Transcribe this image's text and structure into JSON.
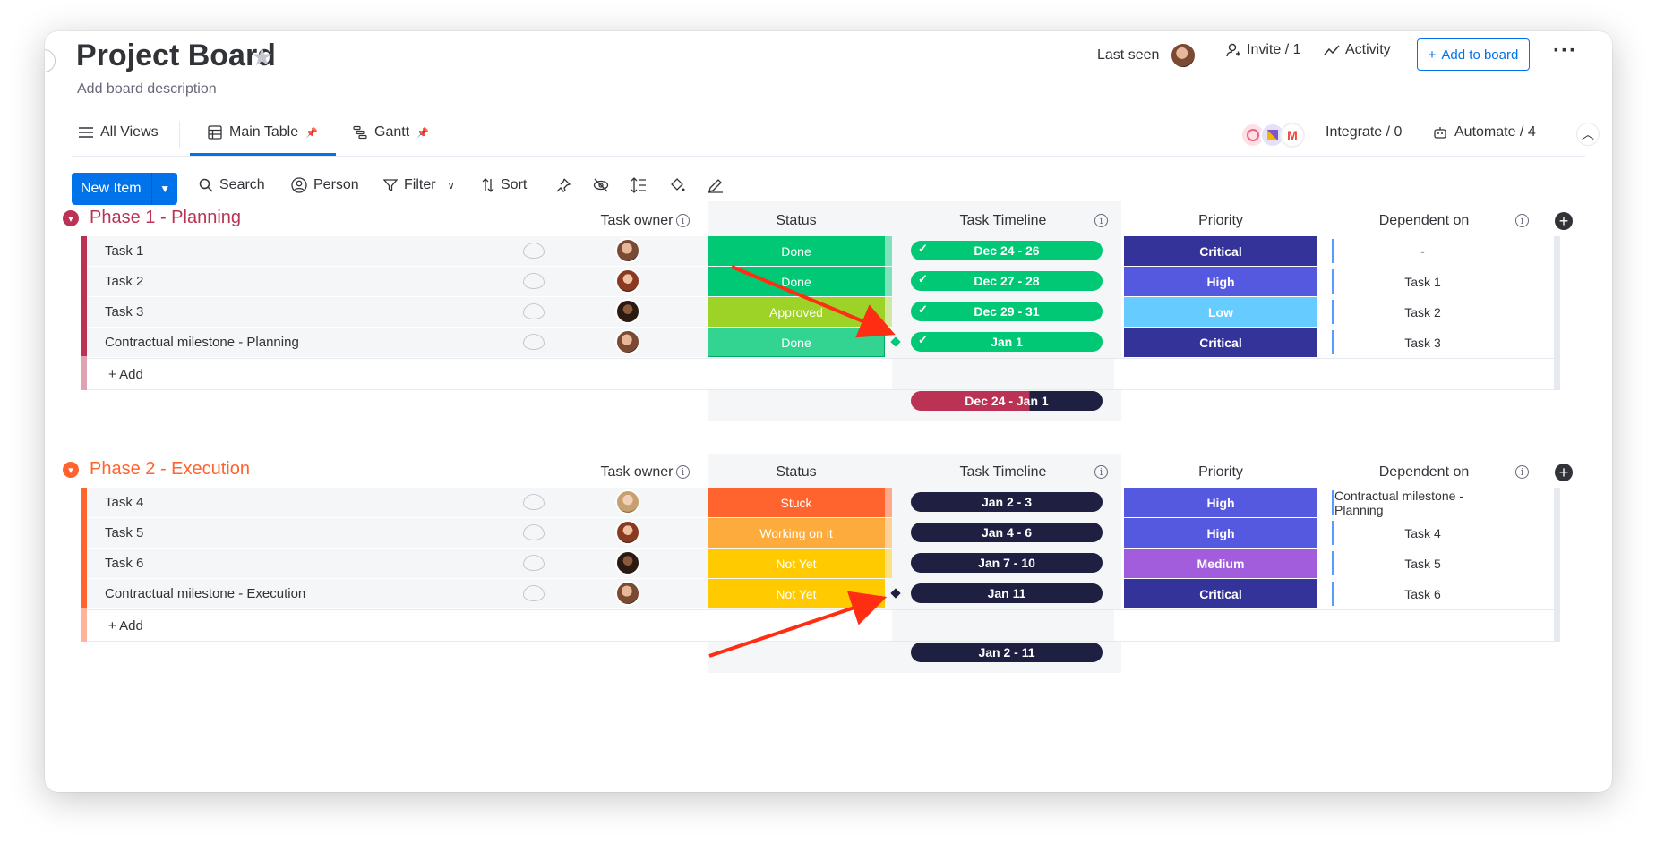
{
  "board": {
    "title": "Project Board",
    "description": "Add board description"
  },
  "header": {
    "last_seen": "Last seen",
    "invite": "Invite / 1",
    "activity": "Activity",
    "add_to_board": "Add to board"
  },
  "tabs": [
    {
      "label": "All Views",
      "icon": "list-icon"
    },
    {
      "label": "Main Table",
      "icon": "table-icon"
    },
    {
      "label": "Gantt",
      "icon": "gantt-icon"
    }
  ],
  "integrations": {
    "integrate": "Integrate / 0",
    "automate": "Automate / 4"
  },
  "toolbar": {
    "new_item": "New Item",
    "search": "Search",
    "person": "Person",
    "filter": "Filter",
    "sort": "Sort"
  },
  "columns": {
    "owner": "Task owner",
    "status": "Status",
    "timeline": "Task Timeline",
    "priority": "Priority",
    "dependent": "Dependent on"
  },
  "groups": [
    {
      "title": "Phase 1 - Planning",
      "color": "#bb3354",
      "add_label": "+ Add",
      "summary": "Dec 24 - Jan 1",
      "rows": [
        {
          "name": "Task 1",
          "status": "Done",
          "status_color": "#00c875",
          "timeline": "Dec 24 - 26",
          "timeline_done": true,
          "priority": "Critical",
          "priority_color": "#333399",
          "dependent": "-"
        },
        {
          "name": "Task 2",
          "status": "Done",
          "status_color": "#00c875",
          "timeline": "Dec 27 - 28",
          "timeline_done": true,
          "priority": "High",
          "priority_color": "#5559df",
          "dependent": "Task 1"
        },
        {
          "name": "Task 3",
          "status": "Approved",
          "status_color": "#9cd326",
          "timeline": "Dec 29 - 31",
          "timeline_done": true,
          "priority": "Low",
          "priority_color": "#66ccff",
          "dependent": "Task 2"
        },
        {
          "name": "Contractual milestone - Planning",
          "status": "Done",
          "status_color": "#33d391",
          "timeline": "Jan 1",
          "timeline_done": true,
          "priority": "Critical",
          "priority_color": "#333399",
          "dependent": "Task 3"
        }
      ]
    },
    {
      "title": "Phase 2 - Execution",
      "color": "#ff642e",
      "add_label": "+ Add",
      "summary": "Jan 2 - 11",
      "rows": [
        {
          "name": "Task 4",
          "status": "Stuck",
          "status_color": "#ff642e",
          "timeline": "Jan 2 - 3",
          "timeline_done": false,
          "priority": "High",
          "priority_color": "#5559df",
          "dependent": "Contractual milestone - Planning"
        },
        {
          "name": "Task 5",
          "status": "Working on it",
          "status_color": "#fdab3d",
          "timeline": "Jan 4 - 6",
          "timeline_done": false,
          "priority": "High",
          "priority_color": "#5559df",
          "dependent": "Task 4"
        },
        {
          "name": "Task 6",
          "status": "Not Yet",
          "status_color": "#ffcb00",
          "timeline": "Jan 7 - 10",
          "timeline_done": false,
          "priority": "Medium",
          "priority_color": "#a25ddc",
          "dependent": "Task 5"
        },
        {
          "name": "Contractual milestone - Execution",
          "status": "Not Yet",
          "status_color": "#ffcb00",
          "timeline": "Jan 11",
          "timeline_done": false,
          "priority": "Critical",
          "priority_color": "#333399",
          "dependent": "Task 6"
        }
      ]
    }
  ],
  "colors": {
    "accent": "#0073ea",
    "timeline_done": "#00c875",
    "timeline_pending": "#1f2041",
    "annotation_arrow": "#ff2d12"
  }
}
